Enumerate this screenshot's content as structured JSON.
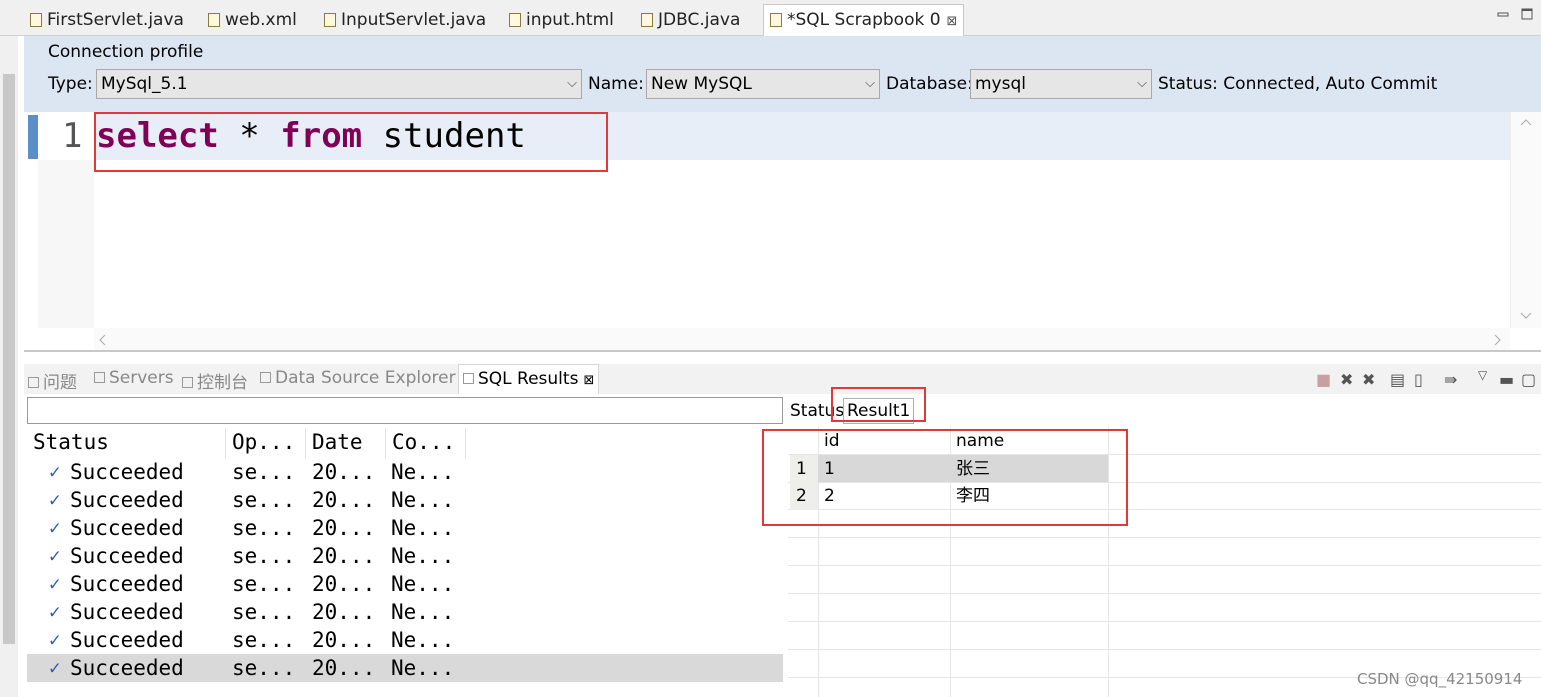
{
  "editor_tabs": [
    {
      "label": "FirstServlet.java"
    },
    {
      "label": "web.xml"
    },
    {
      "label": "InputServlet.java"
    },
    {
      "label": "input.html"
    },
    {
      "label": "JDBC.java"
    },
    {
      "label": "*SQL Scrapbook 0",
      "close": "⊠"
    }
  ],
  "connection": {
    "title": "Connection profile",
    "type_label": "Type:",
    "type_value": "MySql_5.1",
    "name_label": "Name:",
    "name_value": "New MySQL",
    "database_label": "Database:",
    "database_value": "mysql",
    "status": "Status: Connected, Auto Commit"
  },
  "editor": {
    "line_number": "1",
    "keyword1": "select",
    "star": " * ",
    "keyword2": "from",
    "table": " student"
  },
  "views": [
    {
      "label": "问题"
    },
    {
      "label": "Servers"
    },
    {
      "label": "控制台"
    },
    {
      "label": "Data Source Explorer"
    },
    {
      "label": "SQL Results",
      "close": "⊠"
    }
  ],
  "history": {
    "headers": [
      "Status",
      "Op...",
      "Date",
      "Co..."
    ],
    "rows": [
      {
        "status": "Succeeded",
        "op": "se...",
        "date": "20...",
        "conn": "Ne..."
      },
      {
        "status": "Succeeded",
        "op": "se...",
        "date": "20...",
        "conn": "Ne..."
      },
      {
        "status": "Succeeded",
        "op": "se...",
        "date": "20...",
        "conn": "Ne..."
      },
      {
        "status": "Succeeded",
        "op": "se...",
        "date": "20...",
        "conn": "Ne..."
      },
      {
        "status": "Succeeded",
        "op": "se...",
        "date": "20...",
        "conn": "Ne..."
      },
      {
        "status": "Succeeded",
        "op": "se...",
        "date": "20...",
        "conn": "Ne..."
      },
      {
        "status": "Succeeded",
        "op": "se...",
        "date": "20...",
        "conn": "Ne..."
      },
      {
        "status": "Succeeded",
        "op": "se...",
        "date": "20...",
        "conn": "Ne..."
      }
    ],
    "check": "✓"
  },
  "results": {
    "status_tab": "Status",
    "result_tab": "Result1",
    "columns": [
      "id",
      "name"
    ],
    "rows": [
      {
        "num": "1",
        "id": "1",
        "name": "张三"
      },
      {
        "num": "2",
        "id": "2",
        "name": "李四"
      }
    ]
  },
  "watermark": "CSDN @qq_42150914",
  "colors": {
    "keyword": "#7f0055",
    "highlight_box": "#e0393b",
    "conn_bg": "#dce6f2"
  }
}
